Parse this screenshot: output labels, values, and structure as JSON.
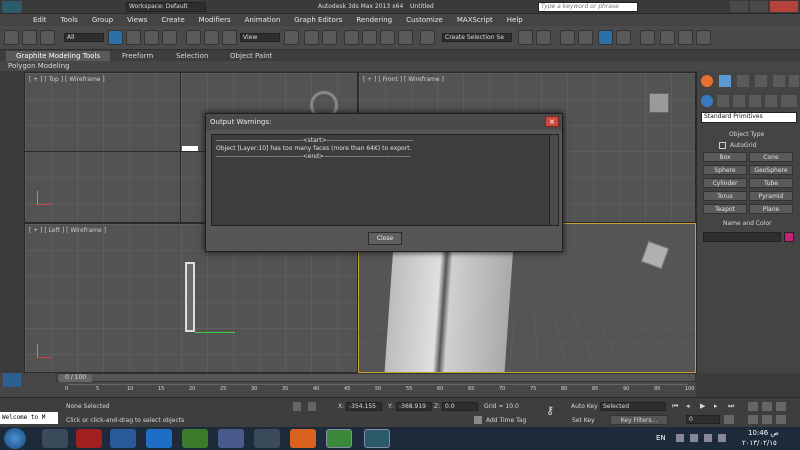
{
  "title": {
    "workspace": "Workspace: Default",
    "app": "Autodesk 3ds Max  2013 x64",
    "doc": "Untitled",
    "search_placeholder": "Type a keyword or phrase"
  },
  "menu": [
    "Edit",
    "Tools",
    "Group",
    "Views",
    "Create",
    "Modifiers",
    "Animation",
    "Graph Editors",
    "Rendering",
    "Customize",
    "MAXScript",
    "Help"
  ],
  "toolbar": {
    "filter": "All",
    "refcoord": "View",
    "selset": "Create Selection Se"
  },
  "ribbon": {
    "tabs": [
      "Graphite Modeling Tools",
      "Freeform",
      "Selection",
      "Object Paint"
    ],
    "sub": "Polygon Modeling"
  },
  "viewports": {
    "top": "[ + ] [ Top ] [ Wireframe ]",
    "front": "[ + ] [ Front ] [ Wireframe ]",
    "left": "[ + ] [ Left ] [ Wireframe ]"
  },
  "panel": {
    "category": "Standard Primitives",
    "rollout1": "Object Type",
    "autogrid": "AutoGrid",
    "buttons": [
      "Box",
      "Cone",
      "Sphere",
      "GeoSphere",
      "Cylinder",
      "Tube",
      "Torus",
      "Pyramid",
      "Teapot",
      "Plane"
    ],
    "rollout2": "Name and Color",
    "color": "#c8217a"
  },
  "dialog": {
    "title": "Output Warnings:",
    "text": "----------------------------------------<start>----------------------------------------\nObject [Layer:10] has too many faces (more than 64K) to export.\n----------------------------------------<end>----------------------------------------",
    "close": "Close"
  },
  "timeline": {
    "counter": "0 / 100",
    "ticks": [
      "0",
      "5",
      "10",
      "15",
      "20",
      "25",
      "30",
      "35",
      "40",
      "45",
      "50",
      "55",
      "60",
      "65",
      "70",
      "75",
      "80",
      "85",
      "90",
      "95",
      "100"
    ]
  },
  "status": {
    "listener": "Welcome to M",
    "selected": "None Selected",
    "prompt": "Click or click-and-drag to select objects",
    "x_label": "X:",
    "x": "-354.155",
    "y_label": "Y:",
    "y": "-368.919",
    "z_label": "Z:",
    "z": "0.0",
    "grid": "Grid = 10.0",
    "addtime": "Add Time Tag",
    "autokey": "Auto Key",
    "keymode": "Selected",
    "setkey": "Set Key",
    "keyfilters": "Key Filters...",
    "frame": "0"
  },
  "taskbar": {
    "lang": "EN",
    "time": "10:46 ص",
    "date": "٢٠١٣/٠٢/١٥"
  }
}
